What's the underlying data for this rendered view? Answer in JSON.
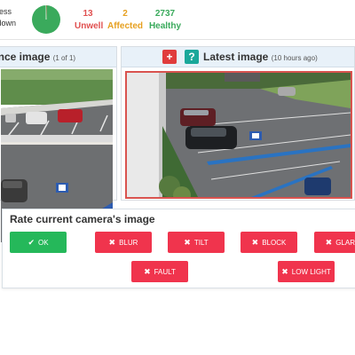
{
  "stats": {
    "label_line1": "ness",
    "label_line2": "tdown",
    "unwell": {
      "value": "13",
      "label": "Unwell"
    },
    "affected": {
      "value": "2",
      "label": "Affected"
    },
    "healthy": {
      "value": "2737",
      "label": "Healthy"
    },
    "pie_colors": {
      "healthy": "#3aaa5c",
      "unwell": "#e05050",
      "affected": "#e6a020"
    }
  },
  "reference_panel": {
    "title": "ence image",
    "counter": "(1 of 1)"
  },
  "latest_panel": {
    "add_button": "+",
    "help_button": "?",
    "title": "Latest image",
    "age": "(10 hours ago)",
    "highlight_color": "#d9534f"
  },
  "rate_panel": {
    "title": "Rate current camera's image",
    "buttons": {
      "ok": "OK",
      "blur": "BLUR",
      "tilt": "TILT",
      "block": "BLOCK",
      "glare": "GLARE",
      "fault": "FAULT",
      "low_light": "LOW LIGHT"
    },
    "colors": {
      "ok": "#25b85a",
      "issue": "#f0344d"
    }
  },
  "icons": {
    "ok_icon": "✔",
    "issue_icon": "✖"
  }
}
